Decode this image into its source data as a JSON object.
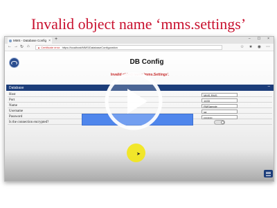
{
  "video": {
    "headline": "Invalid object name ‘mms.settings’"
  },
  "browser": {
    "tab_title": "MMS - Database Config",
    "tab_close": "×",
    "new_tab": "+",
    "cert_warning": "▲ Certificate error",
    "url": "https://localhost/MMS/DatabaseConfiguration",
    "window_controls": [
      "–",
      "☐",
      "×"
    ]
  },
  "page": {
    "title": "DB Config",
    "error_message": "Invalid object name 'mms.Settings'.",
    "section": {
      "title": "Database",
      "collapse_symbol": "–"
    },
    "fields": {
      "host": {
        "label": "Host",
        "value": "MMS-RMS"
      },
      "port": {
        "label": "Port",
        "value": "1433"
      },
      "name": {
        "label": "Name",
        "value": "RMSample"
      },
      "username": {
        "label": "Username",
        "value": "sa"
      },
      "password": {
        "label": "Password",
        "value": "•••••••••"
      }
    },
    "encrypted": {
      "label": "Is the connection encrypted?",
      "checked": false
    }
  },
  "colors": {
    "headline": "#c8102e",
    "section_bar": "#1c3d7a",
    "submit_button": "#4f86ec",
    "error_text": "#c62828",
    "click_indicator": "#f2e61a"
  }
}
